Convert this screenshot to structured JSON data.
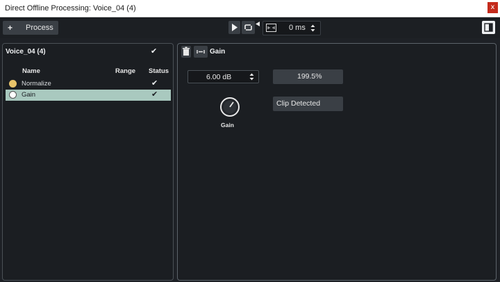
{
  "window": {
    "title": "Direct Offline Processing: Voice_04 (4)",
    "close_glyph": "x"
  },
  "toolbar": {
    "process_plus": "+",
    "process_label": "Process",
    "time_value": "0 ms"
  },
  "left_panel": {
    "title": "Voice_04 (4)",
    "columns": {
      "name": "Name",
      "range": "Range",
      "status": "Status"
    },
    "items": [
      {
        "label": "Normalize",
        "icon": "normalize-icon",
        "selected": false
      },
      {
        "label": "Gain",
        "icon": "gain-icon",
        "selected": true
      }
    ]
  },
  "right_panel": {
    "title": "Gain",
    "gain_value": "6.00 dB",
    "percentage": "199.5%",
    "clip_status": "Clip Detected",
    "knob_label": "Gain"
  },
  "colors": {
    "selection": "#a9c9bf",
    "close": "#c42b1c",
    "background": "#1e2126"
  }
}
